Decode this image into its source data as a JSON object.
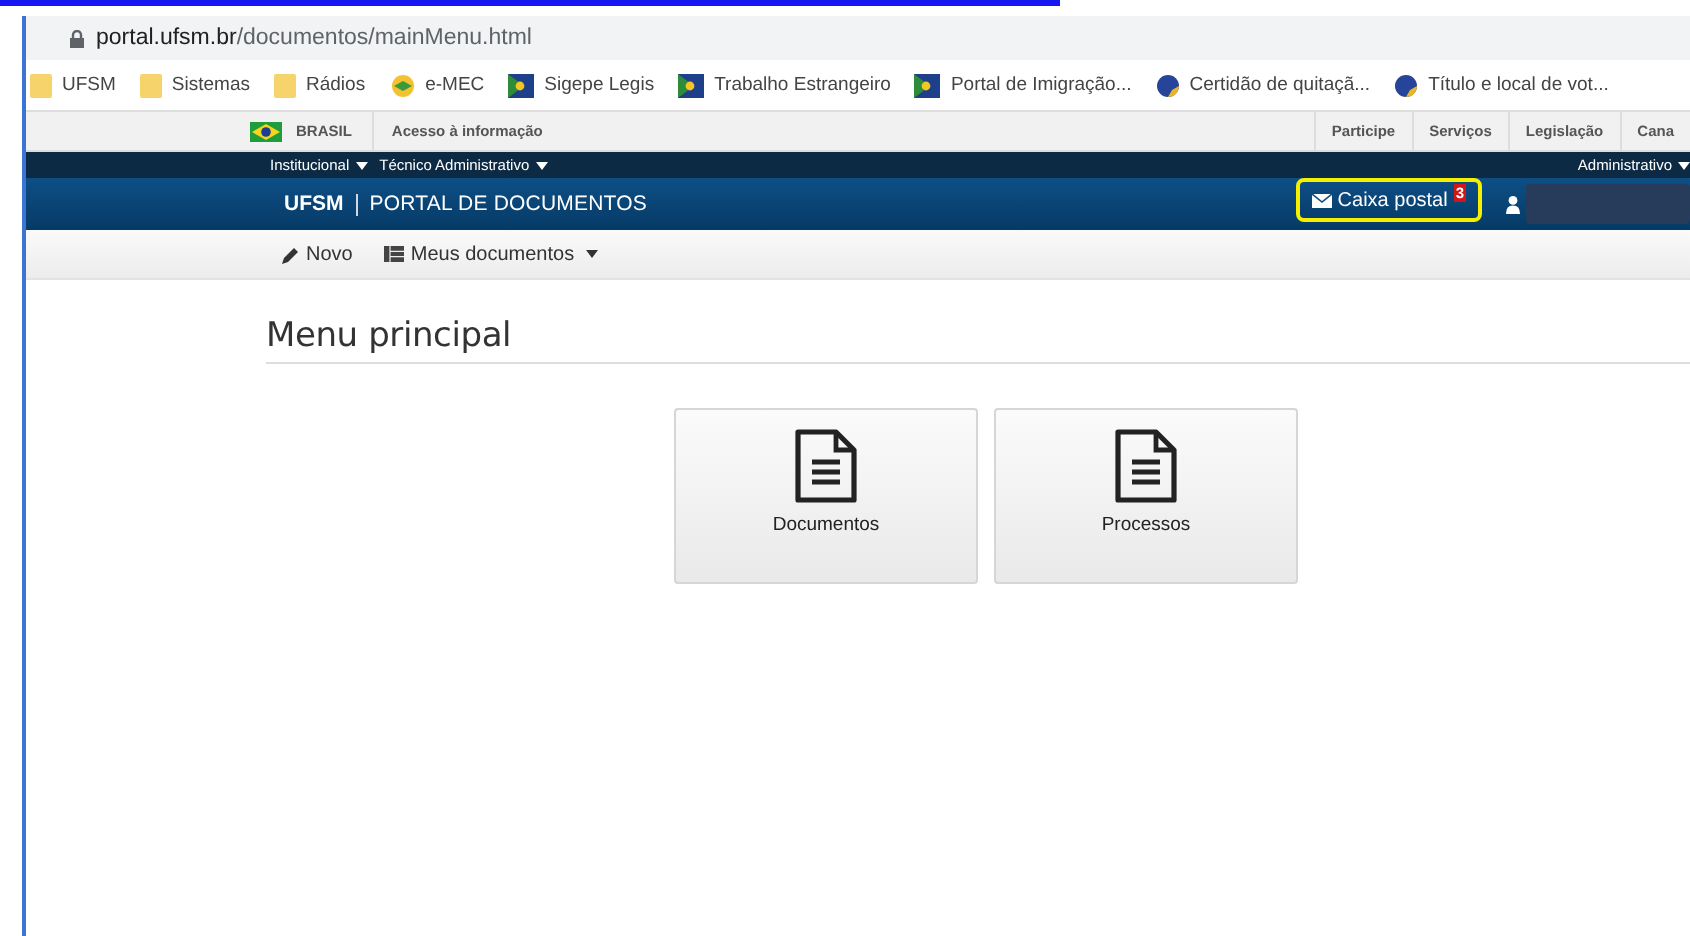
{
  "browser": {
    "url_host": "portal.ufsm.br",
    "url_path": "/documentos/mainMenu.html",
    "bookmarks": [
      {
        "label": "UFSM",
        "kind": "folder"
      },
      {
        "label": "Sistemas",
        "kind": "folder"
      },
      {
        "label": "Rádios",
        "kind": "folder"
      },
      {
        "label": "e-MEC",
        "kind": "book"
      },
      {
        "label": "Sigepe Legis",
        "kind": "flag"
      },
      {
        "label": "Trabalho Estrangeiro",
        "kind": "flag"
      },
      {
        "label": "Portal de Imigração...",
        "kind": "flag"
      },
      {
        "label": "Certidão de quitaçã...",
        "kind": "globe"
      },
      {
        "label": "Título e local de vot...",
        "kind": "globe"
      }
    ]
  },
  "gov_bar": {
    "country": "BRASIL",
    "access_link": "Acesso à informação",
    "links": [
      "Participe",
      "Serviços",
      "Legislação",
      "Cana"
    ]
  },
  "top_menu": {
    "left": [
      "Institucional",
      "Técnico Administrativo"
    ],
    "right": [
      "Administrativo"
    ]
  },
  "header": {
    "brand": "UFSM",
    "title": "PORTAL DE DOCUMENTOS",
    "mailbox": {
      "label": "Caixa postal",
      "badge": "3",
      "highlighted": true
    }
  },
  "nav": [
    {
      "label": "Novo",
      "kind": "pencil",
      "dropdown": false
    },
    {
      "label": "Meus documentos",
      "kind": "list",
      "dropdown": true
    }
  ],
  "page_title": "Menu principal",
  "cards": [
    {
      "label": "Documentos"
    },
    {
      "label": "Processos"
    }
  ]
}
